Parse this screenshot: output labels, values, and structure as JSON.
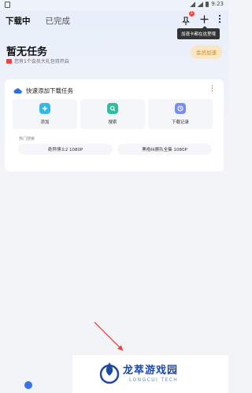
{
  "statusbar": {
    "time": "9:23"
  },
  "tabs": [
    {
      "label": "下载中",
      "active": true
    },
    {
      "label": "已完成",
      "active": false
    }
  ],
  "header": {
    "notification_count": "1",
    "tooltip": "加速卡都在这里哦"
  },
  "main": {
    "title": "暂无任务",
    "promo": "您有1个会员大礼包待开启",
    "vip_button": "会员加速"
  },
  "quick_card": {
    "title": "快速添加下载任务",
    "more": "⋮",
    "tiles": [
      {
        "label": "添加",
        "icon": "plus-icon",
        "color": "#35b8e6"
      },
      {
        "label": "搜索",
        "icon": "search-icon",
        "color": "#2bbfa0"
      },
      {
        "label": "下载记录",
        "icon": "clock-icon",
        "color": "#7a8cf0"
      }
    ],
    "hot_label": "热门搜索",
    "hot": [
      "奇异博士2 1080P",
      "黑袍纠察队全集 1080P"
    ]
  },
  "watermark": {
    "main": "龙萃游戏园",
    "sub": "LONGCUI TECH"
  }
}
